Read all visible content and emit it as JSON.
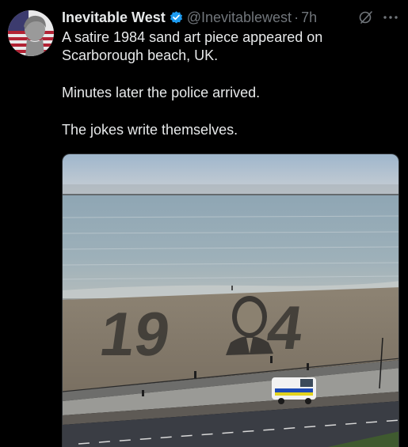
{
  "tweet": {
    "display_name": "Inevitable West",
    "handle": "@Inevitablewest",
    "separator": "·",
    "time": "7h",
    "verified": true,
    "paragraphs": [
      "A satire 1984 sand art piece appeared on Scarborough beach, UK.",
      "Minutes later the police arrived.",
      "The jokes write themselves."
    ]
  },
  "media": {
    "sand_text": "19  4",
    "alt": ""
  },
  "icons": {
    "verified": "verified-badge-icon",
    "grok": "grok-icon",
    "more": "more-icon"
  },
  "colors": {
    "background": "#000000",
    "text": "#e7e9ea",
    "muted": "#71767b",
    "verified": "#1d9bf0"
  }
}
